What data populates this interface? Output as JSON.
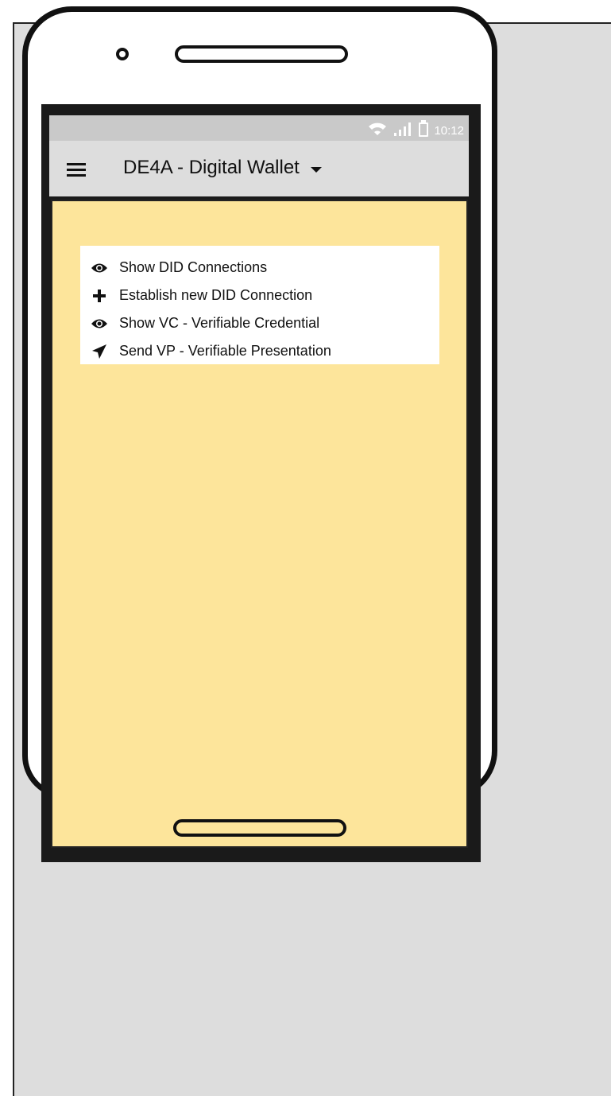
{
  "status_bar": {
    "time": "10:12",
    "icons": [
      "wifi-icon",
      "signal-icon",
      "battery-icon"
    ]
  },
  "app_bar": {
    "menu_icon": "hamburger-icon",
    "title": "DE4A - Digital Wallet",
    "dropdown_icon": "caret-down-icon"
  },
  "menu": {
    "items": [
      {
        "label": "Show DID Connections",
        "icon": "eye-icon"
      },
      {
        "label": "Establish new DID Connection",
        "icon": "plus-icon"
      },
      {
        "label": "Show VC - Verifiable Credential",
        "icon": "eye-icon"
      },
      {
        "label": "Send VP - Verifiable Presentation",
        "icon": "send-icon"
      }
    ]
  },
  "colors": {
    "background": "#dddddd",
    "status_bar": "#c9c9c9",
    "app_bar": "#dddddd",
    "content": "#fde59b",
    "menu_bg": "#ffffff",
    "text": "#111111"
  }
}
